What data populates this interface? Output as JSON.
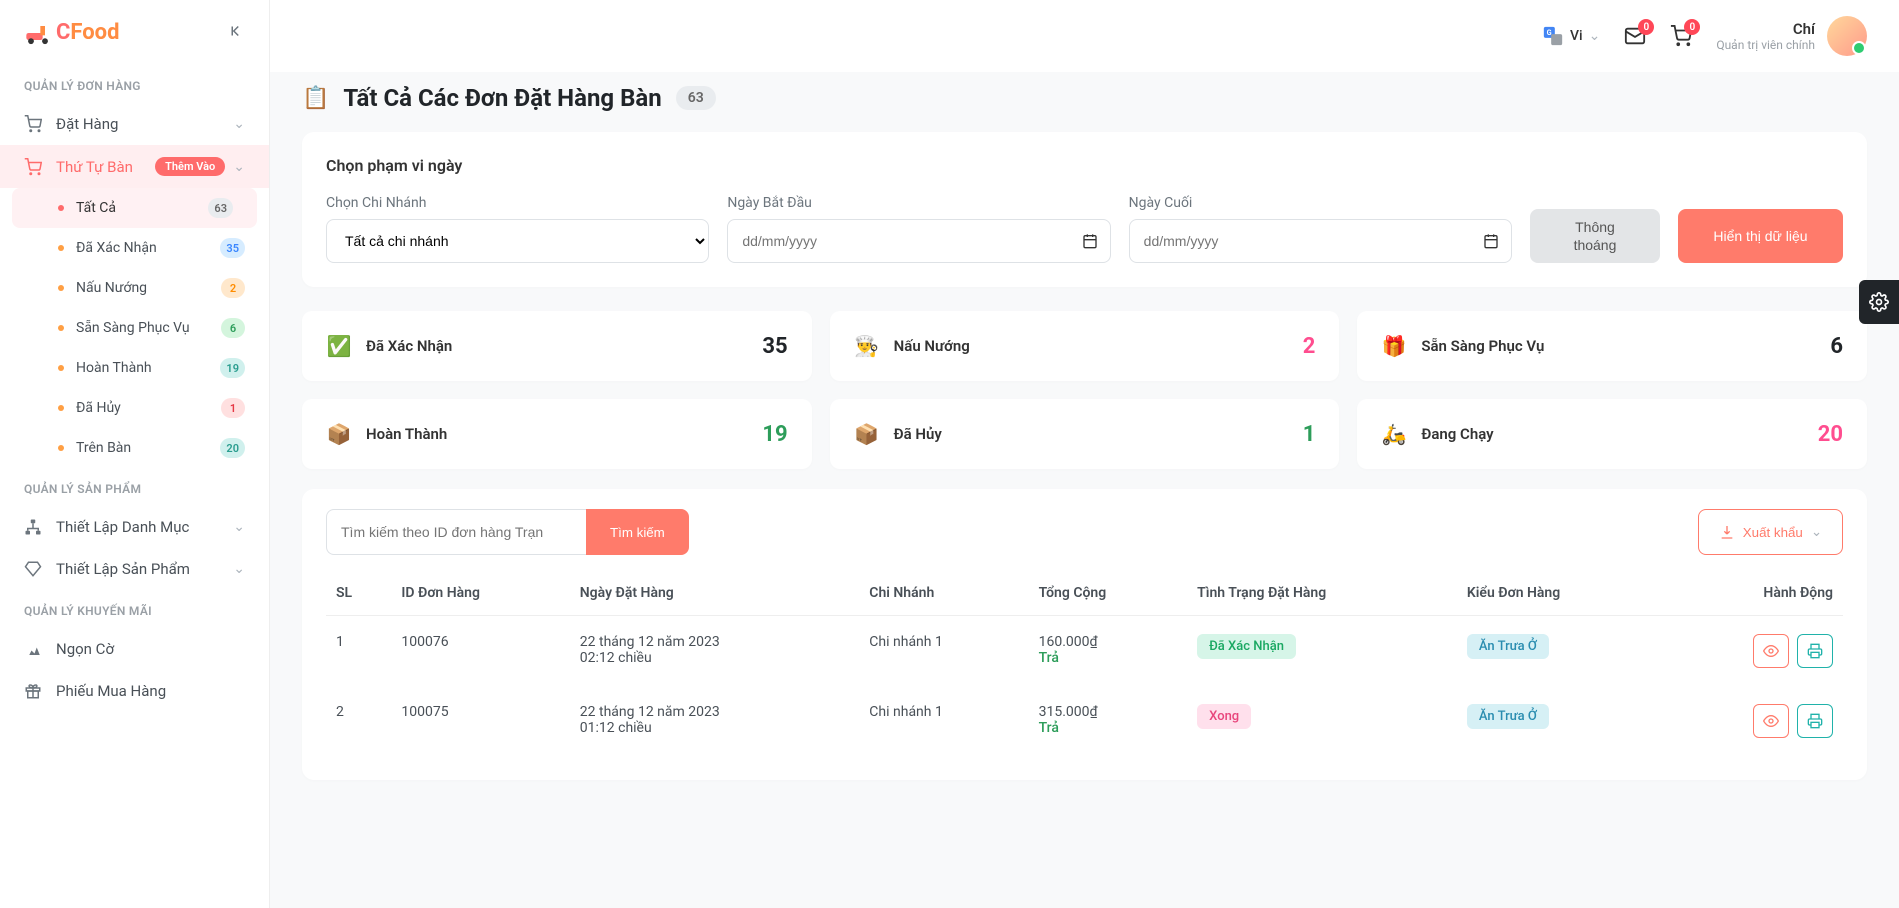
{
  "logo": {
    "brand_c": "C",
    "brand_food": "Food"
  },
  "topbar": {
    "lang": "Vi",
    "mail_count": "0",
    "cart_count": "0",
    "user_name": "Chí",
    "user_role": "Quản trị viên chính"
  },
  "sidebar": {
    "sections": {
      "orders": "QUẢN LÝ ĐƠN HÀNG",
      "products": "QUẢN LÝ SẢN PHẨM",
      "promo": "QUẢN LÝ KHUYẾN MÃI"
    },
    "order_menu": "Đặt Hàng",
    "table_menu": {
      "label": "Thứ Tự Bàn",
      "badge": "Thêm Vào"
    },
    "subs": [
      {
        "label": "Tất Cả",
        "count": "63",
        "pill": "pill-gray",
        "active": true
      },
      {
        "label": "Đã Xác Nhận",
        "count": "35",
        "pill": "pill-blue"
      },
      {
        "label": "Nấu Nướng",
        "count": "2",
        "pill": "pill-orange"
      },
      {
        "label": "Sẵn Sàng Phục Vụ",
        "count": "6",
        "pill": "pill-green"
      },
      {
        "label": "Hoàn Thành",
        "count": "19",
        "pill": "pill-teal"
      },
      {
        "label": "Đã Hủy",
        "count": "1",
        "pill": "pill-red"
      },
      {
        "label": "Trên Bàn",
        "count": "20",
        "pill": "pill-teal"
      }
    ],
    "category_setup": "Thiết Lập Danh Mục",
    "product_setup": "Thiết Lập Sản Phẩm",
    "banner": "Ngọn Cờ",
    "voucher": "Phiếu Mua Hàng"
  },
  "page": {
    "title": "Tất Cả Các Đơn Đặt Hàng Bàn",
    "count": "63"
  },
  "filter": {
    "panel_title": "Chọn phạm vi ngày",
    "branch_label": "Chọn Chi Nhánh",
    "branch_value": "Tất cả chi nhánh",
    "start_label": "Ngày Bắt Đầu",
    "end_label": "Ngày Cuối",
    "date_placeholder": "dd/mm/yyyy",
    "clear_btn": "Thông thoáng",
    "show_btn": "Hiển thị dữ liệu"
  },
  "stats": [
    {
      "icon": "✅",
      "label": "Đã Xác Nhận",
      "value": "35",
      "color": "val-dark"
    },
    {
      "icon": "👨‍🍳",
      "label": "Nấu Nướng",
      "value": "2",
      "color": "val-pink"
    },
    {
      "icon": "🎁",
      "label": "Sẵn Sàng Phục Vụ",
      "value": "6",
      "color": "val-dark"
    },
    {
      "icon": "📦",
      "label": "Hoàn Thành",
      "value": "19",
      "color": "val-green"
    },
    {
      "icon": "📦",
      "label": "Đã Hủy",
      "value": "1",
      "color": "val-green"
    },
    {
      "icon": "🛵",
      "label": "Đang Chạy",
      "value": "20",
      "color": "val-pink"
    }
  ],
  "search": {
    "placeholder": "Tìm kiếm theo ID đơn hàng Trạn",
    "btn": "Tìm kiếm",
    "export": "Xuất khẩu"
  },
  "table": {
    "headers": {
      "sl": "SL",
      "id": "ID Đơn Hàng",
      "date": "Ngày Đặt Hàng",
      "branch": "Chi Nhánh",
      "total": "Tổng Cộng",
      "status": "Tình Trạng Đặt Hàng",
      "type": "Kiểu Đơn Hàng",
      "actions": "Hành Động"
    },
    "rows": [
      {
        "sl": "1",
        "id": "100076",
        "date_l1": "22 tháng 12 năm 2023",
        "date_l2": "02:12 chiều",
        "branch": "Chi nhánh 1",
        "total": "160.000₫",
        "paid": "Trả",
        "status": "Đã Xác Nhận",
        "status_class": "chip-confirmed",
        "type": "Ăn Trưa Ở"
      },
      {
        "sl": "2",
        "id": "100075",
        "date_l1": "22 tháng 12 năm 2023",
        "date_l2": "01:12 chiều",
        "branch": "Chi nhánh 1",
        "total": "315.000₫",
        "paid": "Trả",
        "status": "Xong",
        "status_class": "chip-done",
        "type": "Ăn Trưa Ở"
      }
    ]
  }
}
